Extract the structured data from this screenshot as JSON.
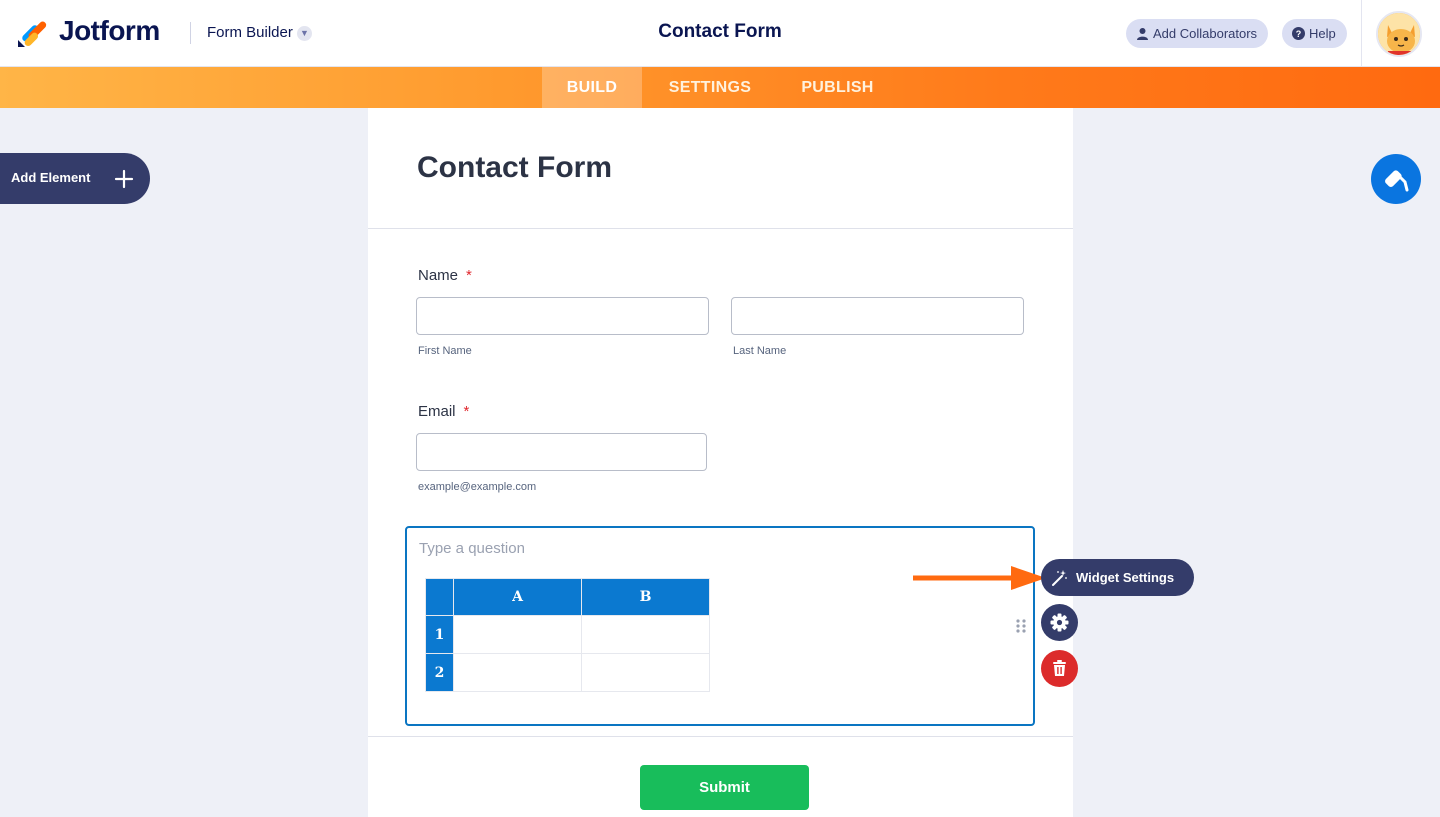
{
  "app": {
    "brand": "Jotform",
    "mode": "Form Builder",
    "form_title": "Contact Form",
    "add_collaborators": "Add Collaborators",
    "help": "Help"
  },
  "tabs": [
    {
      "label": "BUILD",
      "active": true
    },
    {
      "label": "SETTINGS",
      "active": false
    },
    {
      "label": "PUBLISH",
      "active": false
    }
  ],
  "left_panel": {
    "add_element": "Add Element"
  },
  "form": {
    "title": "Contact Form",
    "name_field": {
      "label": "Name",
      "required_mark": "*",
      "first_sublabel": "First Name",
      "last_sublabel": "Last Name"
    },
    "email_field": {
      "label": "Email",
      "required_mark": "*",
      "sublabel": "example@example.com"
    },
    "widget": {
      "question_placeholder": "Type a question",
      "columns": [
        "A",
        "B"
      ],
      "rows": [
        "1",
        "2"
      ]
    },
    "submit_label": "Submit"
  },
  "widget_toolbar": {
    "widget_settings": "Widget Settings",
    "icons": [
      "magic-wand-icon",
      "gear-icon",
      "trash-icon",
      "drag-handle-icon"
    ]
  },
  "colors": {
    "accent_orange": "#ff7a1a",
    "navy": "#343c6a",
    "primary_blue": "#0a75e0",
    "submit_green": "#18bd5b",
    "delete_red": "#dc2b2b"
  }
}
